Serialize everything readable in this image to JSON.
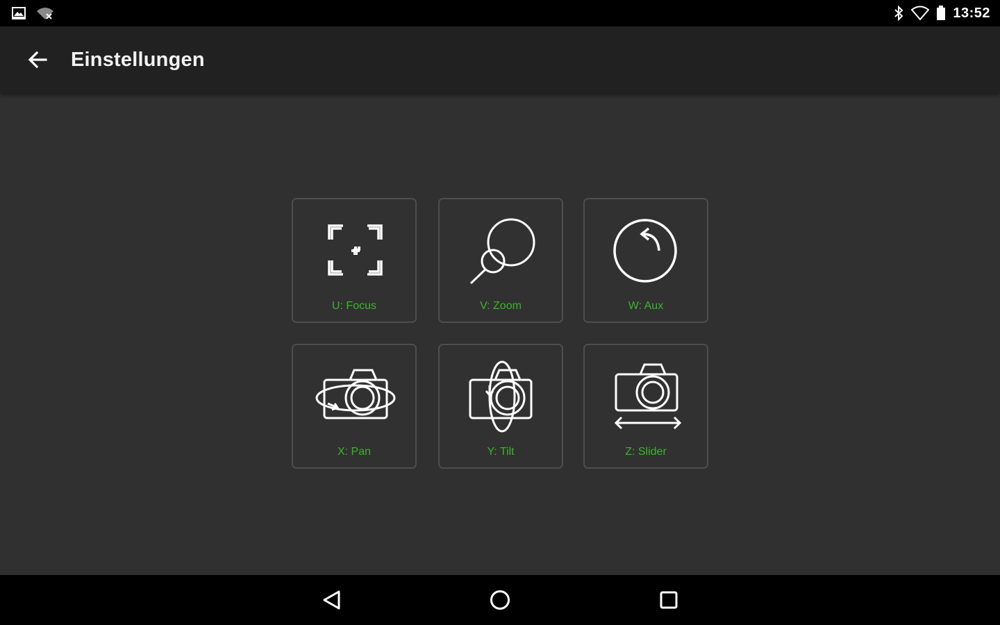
{
  "status_bar": {
    "time": "13:52",
    "left_icons": [
      "image-notification-icon",
      "wifi-off-icon"
    ],
    "right_icons": [
      "bluetooth-icon",
      "wifi-signal-icon",
      "battery-icon"
    ]
  },
  "app_bar": {
    "title": "Einstellungen",
    "back_icon": "arrow-back-icon"
  },
  "tiles": [
    {
      "label": "U: Focus",
      "icon": "focus-icon"
    },
    {
      "label": "V: Zoom",
      "icon": "zoom-icon"
    },
    {
      "label": "W: Aux",
      "icon": "rotate-left-icon"
    },
    {
      "label": "X: Pan",
      "icon": "camera-pan-icon"
    },
    {
      "label": "Y: Tilt",
      "icon": "camera-tilt-icon"
    },
    {
      "label": "Z: Slider",
      "icon": "camera-slider-icon"
    }
  ],
  "nav_bar": {
    "icons": [
      "nav-back-icon",
      "nav-home-icon",
      "nav-recents-icon"
    ]
  },
  "colors": {
    "background": "#303030",
    "app_bar": "#212121",
    "status_bar": "#000000",
    "accent_label": "#3bb52c",
    "tile_border": "#4e4e4e",
    "icon_stroke": "#ffffff"
  }
}
